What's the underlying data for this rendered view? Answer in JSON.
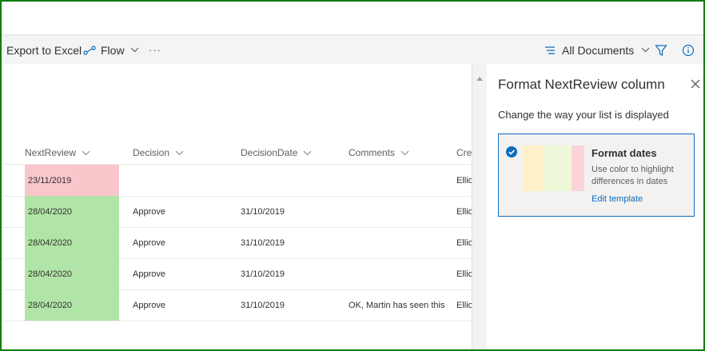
{
  "toolbar": {
    "export_label": "Export to Excel",
    "flow_label": "Flow",
    "more_label": "···",
    "view_label": "All Documents"
  },
  "columns": {
    "nextreview": "NextReview",
    "decision": "Decision",
    "decisiondate": "DecisionDate",
    "comments": "Comments",
    "created": "Crea"
  },
  "rows": [
    {
      "nextreview": "23/11/2019",
      "status": "overdue",
      "decision": "",
      "decisiondate": "",
      "comments": "",
      "created": "Ellio"
    },
    {
      "nextreview": "28/04/2020",
      "status": "ok",
      "decision": "Approve",
      "decisiondate": "31/10/2019",
      "comments": "",
      "created": "Ellio"
    },
    {
      "nextreview": "28/04/2020",
      "status": "ok",
      "decision": "Approve",
      "decisiondate": "31/10/2019",
      "comments": "",
      "created": "Ellio"
    },
    {
      "nextreview": "28/04/2020",
      "status": "ok",
      "decision": "Approve",
      "decisiondate": "31/10/2019",
      "comments": "",
      "created": "Ellio"
    },
    {
      "nextreview": "28/04/2020",
      "status": "ok",
      "decision": "Approve",
      "decisiondate": "31/10/2019",
      "comments": "OK, Martin has seen this",
      "created": "Ellio"
    }
  ],
  "panel": {
    "title": "Format NextReview column",
    "subtitle": "Change the way your list is displayed",
    "card": {
      "title": "Format dates",
      "description": "Use color to highlight differences in dates",
      "link": "Edit template"
    }
  },
  "colors": {
    "frame": "#107c10",
    "overdue": "#f8c6cb",
    "ok": "#b1e5a7",
    "accent": "#0f6cbd",
    "swatch_yellow": "#fff0c8",
    "swatch_green": "#eef7d8",
    "swatch_pink": "#fbd3d8"
  }
}
